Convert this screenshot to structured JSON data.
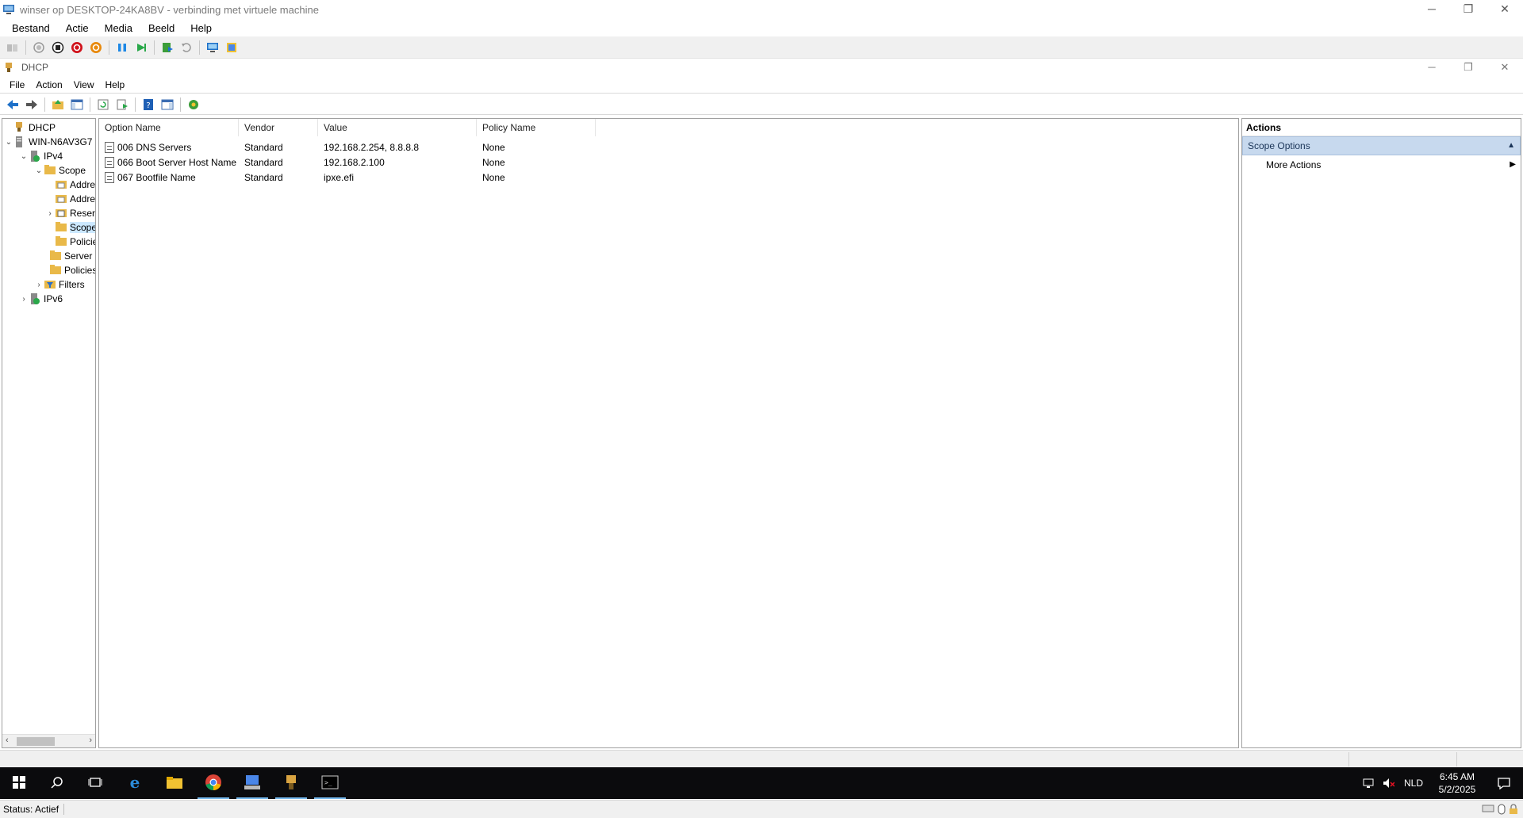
{
  "vm_window": {
    "title": "winser op DESKTOP-24KA8BV - verbinding met virtuele machine",
    "menu": [
      "Bestand",
      "Actie",
      "Media",
      "Beeld",
      "Help"
    ],
    "controls": {
      "minimize": "─",
      "restore": "❐",
      "close": "✕"
    }
  },
  "mmc_window": {
    "title": "DHCP",
    "menu": [
      "File",
      "Action",
      "View",
      "Help"
    ],
    "controls": {
      "minimize": "─",
      "restore": "❐",
      "close": "✕"
    }
  },
  "tree": {
    "items": [
      {
        "label": "DHCP",
        "expander": "",
        "icon": "dhcp-root-icon"
      },
      {
        "label": "WIN-N6AV3G7",
        "expander": "⌄",
        "icon": "server-icon"
      },
      {
        "label": "IPv4",
        "expander": "⌄",
        "icon": "ipv4-icon"
      },
      {
        "label": "Scope",
        "expander": "⌄",
        "icon": "folder-icon"
      },
      {
        "label": "Address Pool",
        "expander": "",
        "icon": "folder-lock-icon"
      },
      {
        "label": "Address Leases",
        "expander": "",
        "icon": "folder-lock-icon"
      },
      {
        "label": "Reservations",
        "expander": "›",
        "icon": "reservations-icon"
      },
      {
        "label": "Scope Options",
        "expander": "",
        "icon": "folder-icon"
      },
      {
        "label": "Policies",
        "expander": "",
        "icon": "folder-icon"
      },
      {
        "label": "Server Options",
        "expander": "",
        "icon": "folder-icon"
      },
      {
        "label": "Policies",
        "expander": "",
        "icon": "folder-icon"
      },
      {
        "label": "Filters",
        "expander": "›",
        "icon": "filters-icon"
      },
      {
        "label": "IPv6",
        "expander": "›",
        "icon": "ipv6-icon"
      }
    ]
  },
  "list": {
    "columns": [
      "Option Name",
      "Vendor",
      "Value",
      "Policy Name"
    ],
    "rows": [
      {
        "name": "006 DNS Servers",
        "vendor": "Standard",
        "value": "192.168.2.254, 8.8.8.8",
        "policy": "None"
      },
      {
        "name": "066 Boot Server Host Name",
        "vendor": "Standard",
        "value": "192.168.2.100",
        "policy": "None"
      },
      {
        "name": "067 Bootfile Name",
        "vendor": "Standard",
        "value": "ipxe.efi",
        "policy": "None"
      }
    ]
  },
  "actions": {
    "header": "Actions",
    "section": "Scope Options",
    "items": [
      "More Actions"
    ]
  },
  "taskbar": {
    "lang": "NLD",
    "time": "6:45 AM",
    "date": "5/2/2025"
  },
  "vm_status": {
    "text": "Status: Actief"
  },
  "colors": {
    "taskbar_bg": "#0b0b0d",
    "actions_section_bg": "#c7d9ee",
    "selection": "#cce8ff"
  }
}
